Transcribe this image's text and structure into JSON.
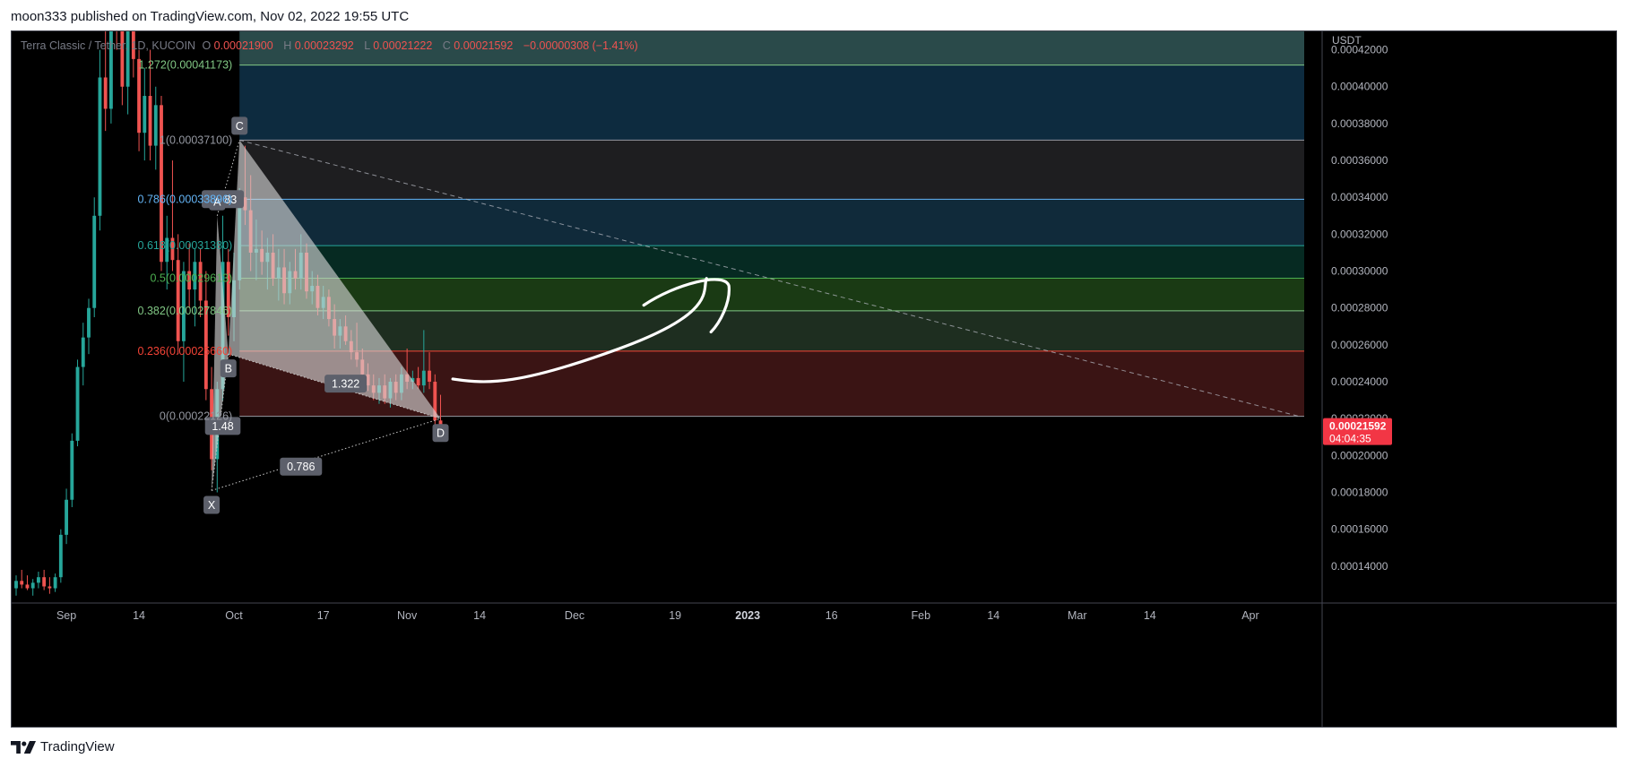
{
  "header": {
    "text": "moon333 published on TradingView.com, Nov 02, 2022 19:55 UTC"
  },
  "footer": {
    "logo_icon": "tradingview-logo-icon",
    "brand": "TradingView"
  },
  "legend": {
    "symbol": "Terra Classic / Tether, 1D, KUCOIN",
    "o_label": "O",
    "o_value": "0.00021900",
    "h_label": "H",
    "h_value": "0.00023292",
    "l_label": "L",
    "l_value": "0.00021222",
    "c_label": "C",
    "c_value": "0.00021592",
    "change": "−0.00000308 (−1.41%)"
  },
  "colors": {
    "background": "#000000",
    "up": "#26a69a",
    "down": "#ef5350",
    "axis_text": "#b2b5be",
    "axis_line": "#434651",
    "harmonic_fill": "#d8d8d8",
    "price_tag": "#f23645"
  },
  "chart_data": {
    "type": "candlestick",
    "symbol": "Terra Classic / Tether",
    "timeframe": "1D",
    "exchange": "KUCOIN",
    "y_axis": {
      "unit_label": "USDT",
      "range": [
        0.00012,
        0.00043
      ],
      "ticks": [
        0.00014,
        0.00016,
        0.00018,
        0.0002,
        0.00022,
        0.00024,
        0.00026,
        0.00028,
        0.0003,
        0.00032,
        0.00034,
        0.00036,
        0.00038,
        0.0004,
        0.00042
      ],
      "tick_labels": [
        "0.00014000",
        "0.00016000",
        "0.00018000",
        "0.00020000",
        "0.00022000",
        "0.00024000",
        "0.00026000",
        "0.00028000",
        "0.00030000",
        "0.00032000",
        "0.00034000",
        "0.00036000",
        "0.00038000",
        "0.00040000",
        "0.00042000"
      ]
    },
    "x_axis": {
      "start": "2022-08-23",
      "end": "2023-04-10",
      "ticks": [
        {
          "date": "2022-09-01",
          "label": "Sep",
          "bold": false
        },
        {
          "date": "2022-09-14",
          "label": "14",
          "bold": false
        },
        {
          "date": "2022-10-01",
          "label": "Oct",
          "bold": false
        },
        {
          "date": "2022-10-17",
          "label": "17",
          "bold": false
        },
        {
          "date": "2022-11-01",
          "label": "Nov",
          "bold": false
        },
        {
          "date": "2022-11-14",
          "label": "14",
          "bold": false
        },
        {
          "date": "2022-12-01",
          "label": "Dec",
          "bold": false
        },
        {
          "date": "2022-12-19",
          "label": "19",
          "bold": false
        },
        {
          "date": "2023-01-01",
          "label": "2023",
          "bold": true
        },
        {
          "date": "2023-01-16",
          "label": "16",
          "bold": false
        },
        {
          "date": "2023-02-01",
          "label": "Feb",
          "bold": false
        },
        {
          "date": "2023-02-14",
          "label": "14",
          "bold": false
        },
        {
          "date": "2023-03-01",
          "label": "Mar",
          "bold": false
        },
        {
          "date": "2023-03-14",
          "label": "14",
          "bold": false
        },
        {
          "date": "2023-04-01",
          "label": "Apr",
          "bold": false
        }
      ]
    },
    "last_price": {
      "label": "0.00021592",
      "countdown": "04:04:35",
      "value": 0.00021592
    },
    "candles": [
      {
        "date": "2022-08-23",
        "o": 0.000128,
        "h": 0.000135,
        "l": 0.000124,
        "c": 0.000132
      },
      {
        "date": "2022-08-24",
        "o": 0.000132,
        "h": 0.000138,
        "l": 0.000128,
        "c": 0.00013
      },
      {
        "date": "2022-08-25",
        "o": 0.00013,
        "h": 0.000135,
        "l": 0.000127,
        "c": 0.000128
      },
      {
        "date": "2022-08-26",
        "o": 0.000128,
        "h": 0.000133,
        "l": 0.000124,
        "c": 0.000131
      },
      {
        "date": "2022-08-27",
        "o": 0.000131,
        "h": 0.000137,
        "l": 0.000128,
        "c": 0.000134
      },
      {
        "date": "2022-08-28",
        "o": 0.000134,
        "h": 0.000138,
        "l": 0.000127,
        "c": 0.000129
      },
      {
        "date": "2022-08-29",
        "o": 0.000129,
        "h": 0.000134,
        "l": 0.000125,
        "c": 0.000128
      },
      {
        "date": "2022-08-30",
        "o": 0.000128,
        "h": 0.000136,
        "l": 0.000126,
        "c": 0.000134
      },
      {
        "date": "2022-08-31",
        "o": 0.000134,
        "h": 0.00016,
        "l": 0.000131,
        "c": 0.000157
      },
      {
        "date": "2022-09-01",
        "o": 0.000157,
        "h": 0.000182,
        "l": 0.000152,
        "c": 0.000176
      },
      {
        "date": "2022-09-02",
        "o": 0.000176,
        "h": 0.000212,
        "l": 0.000172,
        "c": 0.000208
      },
      {
        "date": "2022-09-03",
        "o": 0.000208,
        "h": 0.000252,
        "l": 0.000205,
        "c": 0.000248
      },
      {
        "date": "2022-09-04",
        "o": 0.000248,
        "h": 0.000272,
        "l": 0.000238,
        "c": 0.000264
      },
      {
        "date": "2022-09-05",
        "o": 0.000264,
        "h": 0.000285,
        "l": 0.000255,
        "c": 0.00028
      },
      {
        "date": "2022-09-06",
        "o": 0.00028,
        "h": 0.00034,
        "l": 0.000275,
        "c": 0.00033
      },
      {
        "date": "2022-09-07",
        "o": 0.00033,
        "h": 0.00042,
        "l": 0.000322,
        "c": 0.000405
      },
      {
        "date": "2022-09-08",
        "o": 0.000405,
        "h": 0.00044,
        "l": 0.000376,
        "c": 0.000388
      },
      {
        "date": "2022-09-09",
        "o": 0.000388,
        "h": 0.00045,
        "l": 0.00038,
        "c": 0.00044
      },
      {
        "date": "2022-09-10",
        "o": 0.00044,
        "h": 0.00047,
        "l": 0.00042,
        "c": 0.00043
      },
      {
        "date": "2022-09-11",
        "o": 0.00043,
        "h": 0.00046,
        "l": 0.00039,
        "c": 0.0004
      },
      {
        "date": "2022-09-12",
        "o": 0.0004,
        "h": 0.00044,
        "l": 0.000385,
        "c": 0.00043
      },
      {
        "date": "2022-09-13",
        "o": 0.00043,
        "h": 0.00044,
        "l": 0.000405,
        "c": 0.000415
      },
      {
        "date": "2022-09-14",
        "o": 0.000415,
        "h": 0.00042,
        "l": 0.000365,
        "c": 0.000375
      },
      {
        "date": "2022-09-15",
        "o": 0.000375,
        "h": 0.00041,
        "l": 0.00036,
        "c": 0.000395
      },
      {
        "date": "2022-09-16",
        "o": 0.000395,
        "h": 0.00042,
        "l": 0.00036,
        "c": 0.000368
      },
      {
        "date": "2022-09-17",
        "o": 0.000368,
        "h": 0.0004,
        "l": 0.000355,
        "c": 0.00039
      },
      {
        "date": "2022-09-18",
        "o": 0.00039,
        "h": 0.000395,
        "l": 0.0003,
        "c": 0.000305
      },
      {
        "date": "2022-09-19",
        "o": 0.000305,
        "h": 0.00033,
        "l": 0.00029,
        "c": 0.000318
      },
      {
        "date": "2022-09-20",
        "o": 0.000318,
        "h": 0.00036,
        "l": 0.0003,
        "c": 0.000306
      },
      {
        "date": "2022-09-21",
        "o": 0.000306,
        "h": 0.00032,
        "l": 0.000255,
        "c": 0.000262
      },
      {
        "date": "2022-09-22",
        "o": 0.000262,
        "h": 0.000305,
        "l": 0.00024,
        "c": 0.0003
      },
      {
        "date": "2022-09-23",
        "o": 0.0003,
        "h": 0.000315,
        "l": 0.00028,
        "c": 0.00029
      },
      {
        "date": "2022-09-24",
        "o": 0.00029,
        "h": 0.000312,
        "l": 0.00027,
        "c": 0.000305
      },
      {
        "date": "2022-09-25",
        "o": 0.000305,
        "h": 0.000312,
        "l": 0.000275,
        "c": 0.000284
      },
      {
        "date": "2022-09-26",
        "o": 0.000284,
        "h": 0.0003,
        "l": 0.00023,
        "c": 0.000236
      },
      {
        "date": "2022-09-27",
        "o": 0.000236,
        "h": 0.000248,
        "l": 0.000192,
        "c": 0.000198
      },
      {
        "date": "2022-09-28",
        "o": 0.000198,
        "h": 0.00024,
        "l": 0.00018,
        "c": 0.000236
      },
      {
        "date": "2022-09-29",
        "o": 0.000236,
        "h": 0.00033,
        "l": 0.00023,
        "c": 0.000305
      },
      {
        "date": "2022-09-30",
        "o": 0.000305,
        "h": 0.000312,
        "l": 0.000265,
        "c": 0.000275
      },
      {
        "date": "2022-10-01",
        "o": 0.000275,
        "h": 0.00031,
        "l": 0.000262,
        "c": 0.000295
      },
      {
        "date": "2022-10-02",
        "o": 0.000295,
        "h": 0.000345,
        "l": 0.00029,
        "c": 0.00034
      },
      {
        "date": "2022-10-03",
        "o": 0.00034,
        "h": 0.000368,
        "l": 0.000325,
        "c": 0.000333
      },
      {
        "date": "2022-10-04",
        "o": 0.000333,
        "h": 0.000352,
        "l": 0.0003,
        "c": 0.00031
      },
      {
        "date": "2022-10-05",
        "o": 0.00031,
        "h": 0.000328,
        "l": 0.000295,
        "c": 0.000312
      },
      {
        "date": "2022-10-06",
        "o": 0.000312,
        "h": 0.000322,
        "l": 0.000298,
        "c": 0.000305
      },
      {
        "date": "2022-10-07",
        "o": 0.000305,
        "h": 0.000318,
        "l": 0.00029,
        "c": 0.00031
      },
      {
        "date": "2022-10-08",
        "o": 0.00031,
        "h": 0.00032,
        "l": 0.000292,
        "c": 0.000296
      },
      {
        "date": "2022-10-09",
        "o": 0.000296,
        "h": 0.000312,
        "l": 0.000284,
        "c": 0.000302
      },
      {
        "date": "2022-10-10",
        "o": 0.000302,
        "h": 0.000312,
        "l": 0.000282,
        "c": 0.000288
      },
      {
        "date": "2022-10-11",
        "o": 0.000288,
        "h": 0.000305,
        "l": 0.000282,
        "c": 0.0003
      },
      {
        "date": "2022-10-12",
        "o": 0.0003,
        "h": 0.000312,
        "l": 0.00029,
        "c": 0.000296
      },
      {
        "date": "2022-10-13",
        "o": 0.000296,
        "h": 0.00032,
        "l": 0.00029,
        "c": 0.00031
      },
      {
        "date": "2022-10-14",
        "o": 0.00031,
        "h": 0.000315,
        "l": 0.000285,
        "c": 0.000289
      },
      {
        "date": "2022-10-15",
        "o": 0.000289,
        "h": 0.0003,
        "l": 0.000282,
        "c": 0.000292
      },
      {
        "date": "2022-10-16",
        "o": 0.000292,
        "h": 0.000298,
        "l": 0.000276,
        "c": 0.00028
      },
      {
        "date": "2022-10-17",
        "o": 0.00028,
        "h": 0.000292,
        "l": 0.000274,
        "c": 0.000286
      },
      {
        "date": "2022-10-18",
        "o": 0.000286,
        "h": 0.00029,
        "l": 0.00027,
        "c": 0.000274
      },
      {
        "date": "2022-10-19",
        "o": 0.000274,
        "h": 0.000282,
        "l": 0.000258,
        "c": 0.000265
      },
      {
        "date": "2022-10-20",
        "o": 0.000265,
        "h": 0.000274,
        "l": 0.000258,
        "c": 0.00027
      },
      {
        "date": "2022-10-21",
        "o": 0.00027,
        "h": 0.000276,
        "l": 0.00026,
        "c": 0.000262
      },
      {
        "date": "2022-10-22",
        "o": 0.000262,
        "h": 0.000268,
        "l": 0.000252,
        "c": 0.000256
      },
      {
        "date": "2022-10-23",
        "o": 0.000256,
        "h": 0.000272,
        "l": 0.000248,
        "c": 0.000252
      },
      {
        "date": "2022-10-24",
        "o": 0.000252,
        "h": 0.000258,
        "l": 0.00024,
        "c": 0.000244
      },
      {
        "date": "2022-10-25",
        "o": 0.000244,
        "h": 0.00025,
        "l": 0.000235,
        "c": 0.000238
      },
      {
        "date": "2022-10-26",
        "o": 0.000238,
        "h": 0.000244,
        "l": 0.00023,
        "c": 0.000234
      },
      {
        "date": "2022-10-27",
        "o": 0.000234,
        "h": 0.000242,
        "l": 0.000228,
        "c": 0.000238
      },
      {
        "date": "2022-10-28",
        "o": 0.000238,
        "h": 0.000244,
        "l": 0.000228,
        "c": 0.000231
      },
      {
        "date": "2022-10-29",
        "o": 0.000231,
        "h": 0.000242,
        "l": 0.000226,
        "c": 0.00024
      },
      {
        "date": "2022-10-30",
        "o": 0.00024,
        "h": 0.000244,
        "l": 0.00023,
        "c": 0.000234
      },
      {
        "date": "2022-10-31",
        "o": 0.000234,
        "h": 0.000248,
        "l": 0.00023,
        "c": 0.000244
      },
      {
        "date": "2022-11-01",
        "o": 0.000244,
        "h": 0.000258,
        "l": 0.000236,
        "c": 0.00024
      },
      {
        "date": "2022-11-02",
        "o": 0.00024,
        "h": 0.000246,
        "l": 0.000236,
        "c": 0.000242
      },
      {
        "date": "2022-11-03",
        "o": 0.000242,
        "h": 0.000248,
        "l": 0.000236,
        "c": 0.000238
      },
      {
        "date": "2022-11-04",
        "o": 0.000238,
        "h": 0.000268,
        "l": 0.000234,
        "c": 0.000246
      },
      {
        "date": "2022-11-05",
        "o": 0.000246,
        "h": 0.000256,
        "l": 0.000236,
        "c": 0.00024
      },
      {
        "date": "2022-11-06",
        "o": 0.00024,
        "h": 0.000244,
        "l": 0.000212,
        "c": 0.000219
      },
      {
        "date": "2022-11-07",
        "o": 0.000219,
        "h": 0.00023292,
        "l": 0.00021222,
        "c": 0.00021592
      }
    ],
    "fib_retracement": {
      "base_price": 0.00022126,
      "top_price": 0.000371,
      "levels": [
        {
          "ratio": 1.272,
          "label": "1.272(0.00041173)",
          "price": 0.00041173,
          "color": "#81c784",
          "fill": "#2a4a4a"
        },
        {
          "ratio": 1.0,
          "label": "1(0.00037100)",
          "price": 0.000371,
          "color": "#9598a1",
          "fill": "#0d2b3f"
        },
        {
          "ratio": 0.786,
          "label": "0.786(0.00033896)",
          "price": 0.00033896,
          "color": "#64b5f6",
          "fill": "#1e1e20"
        },
        {
          "ratio": 0.618,
          "label": "0.618(0.00031380)",
          "price": 0.0003138,
          "color": "#26a69a",
          "fill": "#102a3a"
        },
        {
          "ratio": 0.5,
          "label": "0.5(0.00029613)",
          "price": 0.00029613,
          "color": "#4caf50",
          "fill": "#062a22"
        },
        {
          "ratio": 0.382,
          "label": "0.382(0.00027846)",
          "price": 0.00027846,
          "color": "#81c784",
          "fill": "#1a3a14"
        },
        {
          "ratio": 0.236,
          "label": "0.236(0.00025660)",
          "price": 0.0002566,
          "color": "#f44336",
          "fill": "#1e2e20"
        },
        {
          "ratio": 0,
          "label": "0(0.00022126)",
          "price": 0.00022126,
          "color": "#9598a1",
          "fill": "#3a1414"
        }
      ]
    },
    "harmonic_pattern": {
      "points": [
        {
          "name": "X",
          "date": "2022-09-27",
          "price": 0.000181,
          "label_pos": "below"
        },
        {
          "name": "A",
          "date": "2022-09-28",
          "price": 0.00033,
          "label_pos": "above"
        },
        {
          "name": "B",
          "date": "2022-09-30",
          "price": 0.000255,
          "label_pos": "below"
        },
        {
          "name": "C",
          "date": "2022-10-02",
          "price": 0.000371,
          "label_pos": "above"
        },
        {
          "name": "D",
          "date": "2022-11-07",
          "price": 0.00022,
          "label_pos": "below"
        }
      ],
      "ratios": [
        {
          "label": "1.283",
          "date": "2022-09-29",
          "price": 0.000339
        },
        {
          "label": "1.322",
          "date": "2022-10-21",
          "price": 0.000239
        },
        {
          "label": "0.786",
          "date": "2022-10-13",
          "price": 0.000194
        },
        {
          "label": "1.48",
          "date": "2022-09-29",
          "price": 0.000216
        }
      ]
    },
    "trend_line": {
      "start": {
        "date": "2022-10-02",
        "price": 0.000371
      },
      "end": {
        "date": "2023-04-10",
        "price": 0.000221
      }
    },
    "annotation_arrow": {
      "style": "hand-drawn curved arrow pointing up-right",
      "color": "#ffffff"
    }
  }
}
